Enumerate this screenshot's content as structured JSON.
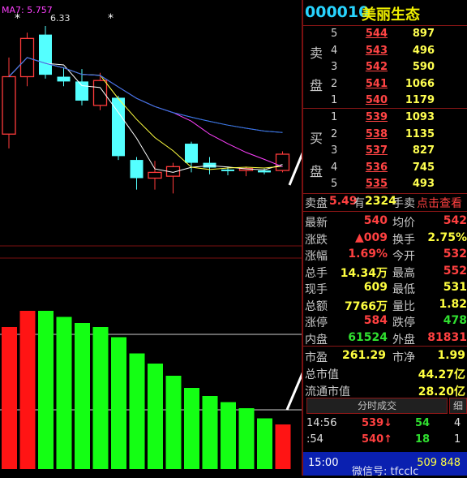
{
  "chart": {
    "ma_label": "MA7: 5.757",
    "high_label": "6.33",
    "star1": "*",
    "star2": "*",
    "candles": [
      {
        "o": 5.2,
        "c": 5.8,
        "h": 6.0,
        "l": 5.05,
        "up": true
      },
      {
        "o": 5.8,
        "c": 6.2,
        "h": 6.26,
        "l": 5.7,
        "up": true
      },
      {
        "o": 6.24,
        "c": 5.82,
        "h": 6.33,
        "l": 5.78,
        "up": false
      },
      {
        "o": 5.8,
        "c": 5.75,
        "h": 5.9,
        "l": 5.7,
        "up": false
      },
      {
        "o": 5.75,
        "c": 5.55,
        "h": 5.88,
        "l": 5.5,
        "up": false
      },
      {
        "o": 5.5,
        "c": 5.76,
        "h": 5.84,
        "l": 5.45,
        "up": true
      },
      {
        "o": 5.58,
        "c": 4.97,
        "h": 5.6,
        "l": 4.93,
        "up": false
      },
      {
        "o": 4.93,
        "c": 4.74,
        "h": 4.96,
        "l": 4.62,
        "up": false
      },
      {
        "o": 4.74,
        "c": 4.8,
        "h": 4.92,
        "l": 4.62,
        "up": true
      },
      {
        "o": 4.76,
        "c": 4.86,
        "h": 4.9,
        "l": 4.58,
        "up": true
      },
      {
        "o": 5.1,
        "c": 4.9,
        "h": 5.12,
        "l": 4.8,
        "up": false
      },
      {
        "o": 4.9,
        "c": 4.85,
        "h": 4.96,
        "l": 4.78,
        "up": false
      },
      {
        "o": 4.83,
        "c": 4.82,
        "h": 4.86,
        "l": 4.77,
        "up": false
      },
      {
        "o": 4.82,
        "c": 4.84,
        "h": 4.86,
        "l": 4.76,
        "up": true
      },
      {
        "o": 4.8,
        "c": 4.82,
        "h": 4.84,
        "l": 4.78,
        "up": false
      },
      {
        "o": 4.82,
        "c": 4.99,
        "h": 5.02,
        "l": 4.8,
        "up": true
      }
    ],
    "macd": [
      {
        "v": 0.7,
        "c": "red"
      },
      {
        "v": 0.78,
        "c": "red"
      },
      {
        "v": 0.78,
        "c": "green"
      },
      {
        "v": 0.75,
        "c": "green"
      },
      {
        "v": 0.72,
        "c": "green"
      },
      {
        "v": 0.7,
        "c": "green"
      },
      {
        "v": 0.65,
        "c": "green"
      },
      {
        "v": 0.57,
        "c": "green"
      },
      {
        "v": 0.52,
        "c": "green"
      },
      {
        "v": 0.46,
        "c": "green"
      },
      {
        "v": 0.4,
        "c": "green"
      },
      {
        "v": 0.36,
        "c": "green"
      },
      {
        "v": 0.33,
        "c": "green"
      },
      {
        "v": 0.3,
        "c": "green"
      },
      {
        "v": 0.25,
        "c": "green"
      },
      {
        "v": 0.22,
        "c": "red"
      }
    ]
  },
  "panel": {
    "code": "000010",
    "name": "美丽生态",
    "sell_label_1": "卖",
    "sell_label_2": "盘",
    "buy_label_1": "买",
    "buy_label_2": "盘",
    "sell": [
      {
        "lv": "5",
        "price": "544",
        "vol": "897"
      },
      {
        "lv": "4",
        "price": "543",
        "vol": "496"
      },
      {
        "lv": "3",
        "price": "542",
        "vol": "590"
      },
      {
        "lv": "2",
        "price": "541",
        "vol": "1066"
      },
      {
        "lv": "1",
        "price": "540",
        "vol": "1179"
      }
    ],
    "buy": [
      {
        "lv": "1",
        "price": "539",
        "vol": "1093"
      },
      {
        "lv": "2",
        "price": "538",
        "vol": "1135"
      },
      {
        "lv": "3",
        "price": "537",
        "vol": "827"
      },
      {
        "lv": "4",
        "price": "536",
        "vol": "745"
      },
      {
        "lv": "5",
        "price": "535",
        "vol": "493"
      }
    ],
    "weibi": {
      "label": "卖盘",
      "ratio": "5.49",
      "has": "有",
      "vol": "2324",
      "unit": "手卖",
      "link": "点击查看"
    },
    "stats": {
      "zuixin_l": "最新",
      "zuixin_v": "540",
      "junjia_l": "均价",
      "junjia_v": "542",
      "zhangdie_l": "涨跌",
      "zhangdie_v": "▲009",
      "huanshou_l": "换手",
      "huanshou_v": "2.75%",
      "zhangfu_l": "涨幅",
      "zhangfu_v": "1.69%",
      "jinkai_l": "今开",
      "jinkai_v": "532",
      "zongshou_l": "总手",
      "zongshou_v": "14.34万",
      "zuigao_l": "最高",
      "zuigao_v": "552",
      "xianshou_l": "现手",
      "xianshou_v": "609",
      "zuidi_l": "最低",
      "zuidi_v": "531",
      "zonge_l": "总额",
      "zonge_v": "7766万",
      "liangbi_l": "量比",
      "liangbi_v": "1.82",
      "zhangting_l": "涨停",
      "zhangting_v": "584",
      "dieting_l": "跌停",
      "dieting_v": "478",
      "neipan_l": "内盘",
      "neipan_v": "61524",
      "waipan_l": "外盘",
      "waipan_v": "81831",
      "shiying_l": "市盈",
      "shiying_v": "261.29",
      "shijing_l": "市净",
      "shijing_v": "1.99",
      "zsz_l": "总市值",
      "zsz_v": "44.27亿",
      "ltsz_l": "流通市值",
      "ltsz_v": "28.20亿"
    },
    "ticks_header": "分时成交",
    "ticks_xi": "细",
    "ticks": [
      {
        "t": "14:56",
        "p": "539↓",
        "v": "54",
        "n": "4"
      },
      {
        "t": ":54",
        "p": "540↑",
        "v": "18",
        "n": "1"
      }
    ],
    "last_time": "15:00",
    "last_tail": "509 848"
  },
  "watermark": "微信号: tfcclc"
}
